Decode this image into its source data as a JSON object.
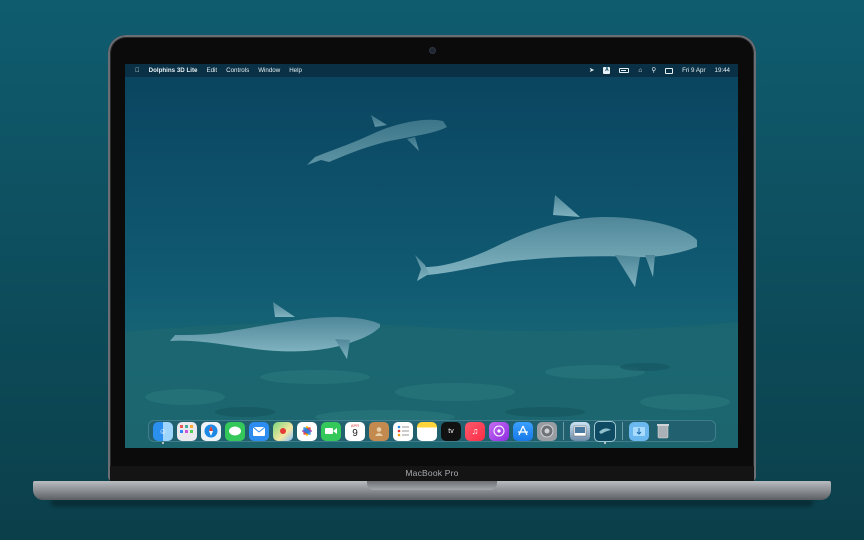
{
  "menubar": {
    "app_name": "Dolphins 3D Lite",
    "items": [
      "Edit",
      "Controls",
      "Window",
      "Help"
    ],
    "status": {
      "keyboard_label": "A",
      "datetime_date": "Fri 9 Apr",
      "datetime_time": "19:44"
    }
  },
  "dock": {
    "calendar_month": "APR",
    "calendar_day": "9",
    "tv_label": "tv"
  },
  "hardware": {
    "brand_label": "MacBook Pro"
  },
  "colors": {
    "water": "#0c4a62",
    "background": "#0f5c6f",
    "dolphin": "#5f97a8"
  }
}
